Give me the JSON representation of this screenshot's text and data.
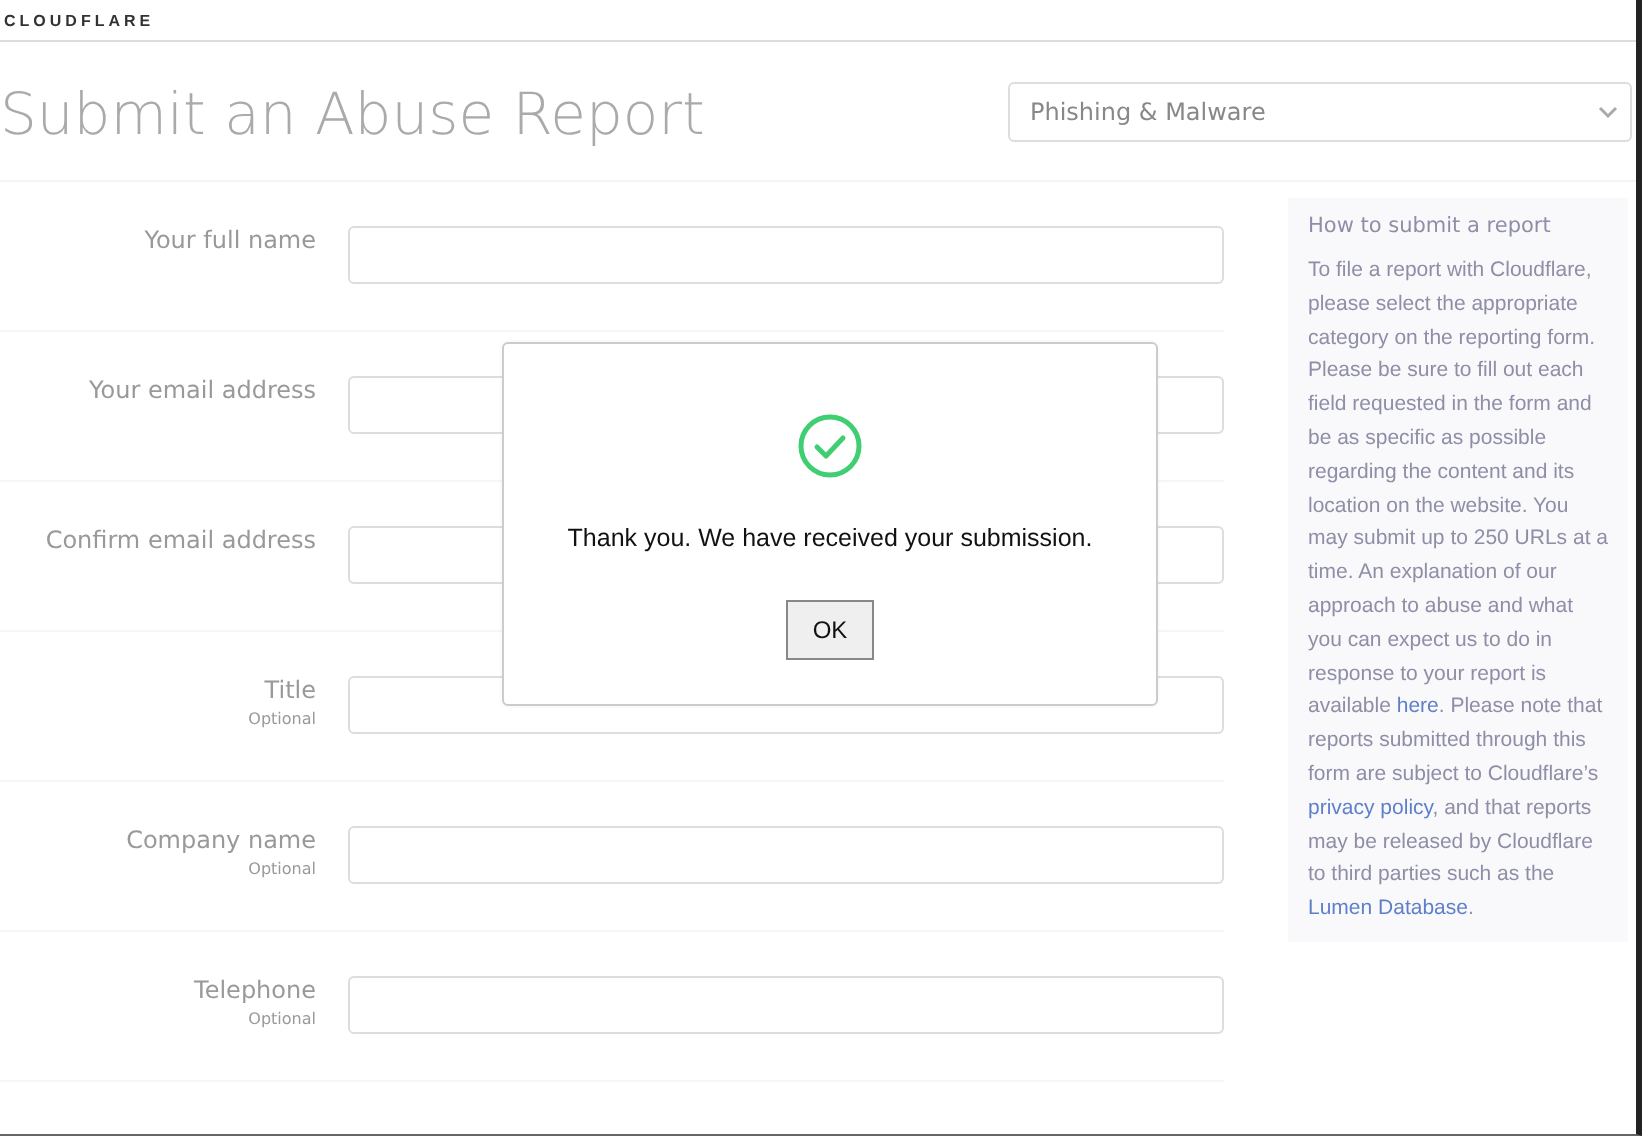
{
  "header": {
    "logo": "CLOUDFLARE"
  },
  "page": {
    "title": "Submit an Abuse Report",
    "category_select": "Phishing & Malware"
  },
  "form": {
    "fields": [
      {
        "label": "Your full name"
      },
      {
        "label": "Your email address"
      },
      {
        "label": "Confirm email address"
      },
      {
        "label": "Title",
        "note": "Optional"
      },
      {
        "label": "Company name",
        "note": "Optional"
      },
      {
        "label": "Telephone",
        "note": "Optional"
      }
    ]
  },
  "sidebar": {
    "heading": "How to submit a report",
    "body": [
      {
        "kind": "text",
        "text": "To file a report with Cloudflare, please select the appropriate category on the reporting form. Please be sure to fill out each field requested in the form and be as specific as possible regarding the content and its location on the website. You may submit up to 250 URLs at a time. An explanation of our approach to abuse and what you can expect us to do in response to your report is available "
      },
      {
        "kind": "link",
        "text": "here"
      },
      {
        "kind": "text",
        "text": ". Please note that reports submitted through this form are subject to Cloudflare’s "
      },
      {
        "kind": "link",
        "text": "privacy policy"
      },
      {
        "kind": "text",
        "text": ", and that reports may be released by Cloudflare to third parties such as the "
      },
      {
        "kind": "link",
        "text": "Lumen Database"
      },
      {
        "kind": "text",
        "text": "."
      }
    ]
  },
  "dialog": {
    "message": "Thank you. We have received your submission.",
    "button": "OK"
  }
}
